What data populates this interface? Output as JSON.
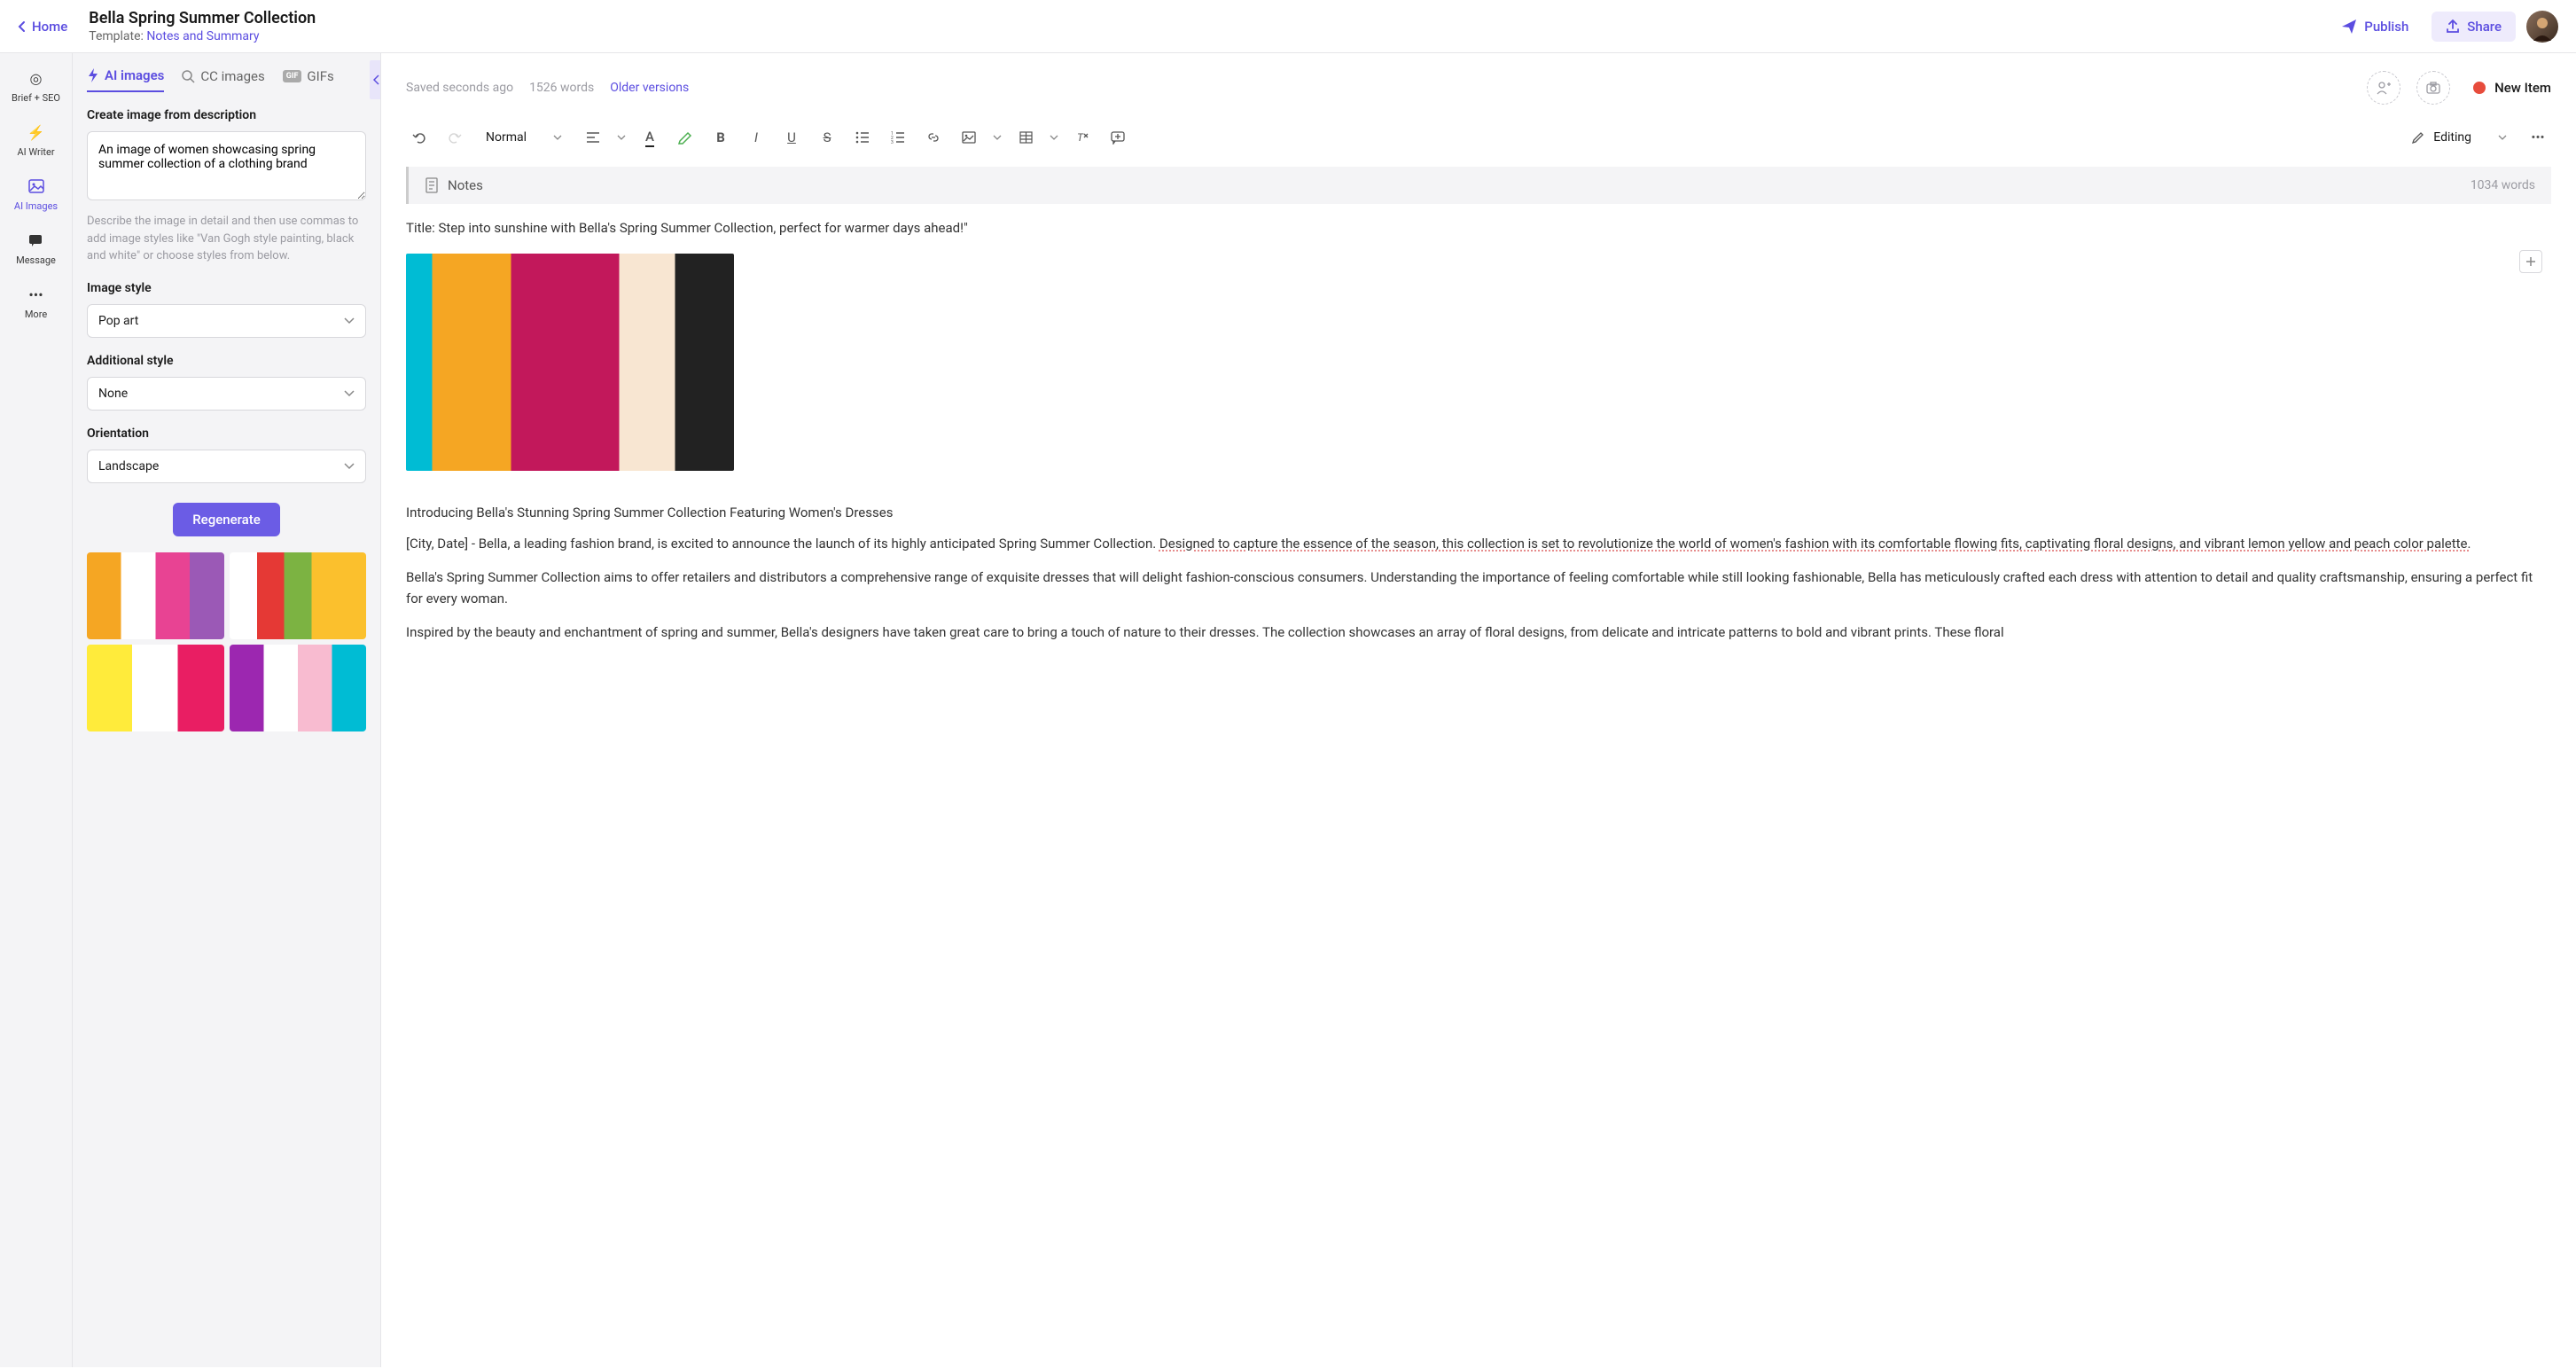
{
  "header": {
    "home": "Home",
    "title": "Bella Spring Summer Collection",
    "template_prefix": "Template: ",
    "template_name": "Notes and Summary",
    "publish": "Publish",
    "share": "Share"
  },
  "rail": {
    "brief": "Brief + SEO",
    "writer": "AI Writer",
    "images": "AI Images",
    "message": "Message",
    "more": "More"
  },
  "panel": {
    "tabs": {
      "ai": "AI images",
      "cc": "CC images",
      "gifs": "GIFs"
    },
    "desc_label": "Create image from description",
    "desc_value": "An image of women showcasing spring summer collection of a clothing brand",
    "desc_hint": "Describe the image in detail and then use commas to add image styles like \"Van Gogh style painting, black and white\" or choose styles from below.",
    "style_label": "Image style",
    "style_value": "Pop art",
    "addl_label": "Additional style",
    "addl_value": "None",
    "orient_label": "Orientation",
    "orient_value": "Landscape",
    "regenerate": "Regenerate"
  },
  "editor": {
    "saved": "Saved seconds ago",
    "words": "1526 words",
    "versions": "Older versions",
    "new_item": "New Item",
    "format": "Normal",
    "editing": "Editing",
    "notes_label": "Notes",
    "notes_words": "1034 words"
  },
  "content": {
    "title_line": "Title: Step into sunshine with Bella's Spring Summer Collection, perfect for warmer days ahead!\"",
    "heading": "Introducing Bella's Stunning Spring Summer Collection Featuring Women's Dresses",
    "p1_a": "[City, Date] - Bella, a leading fashion brand, is excited to announce the launch of its highly anticipated Spring Summer Collection. ",
    "p1_b": "Designed to capture the essence of the season, this collection is set to revolutionize the world of women's fashion with its comfortable flowing fits, captivating floral designs, and vibrant lemon yellow and peach color palette.",
    "p2": "Bella's Spring Summer Collection aims to offer retailers and distributors a comprehensive range of exquisite dresses that will delight fashion-conscious consumers. Understanding the importance of feeling comfortable while still looking fashionable, Bella has meticulously crafted each dress with attention to detail and quality craftsmanship, ensuring a perfect fit for every woman.",
    "p3": "Inspired by the beauty and enchantment of spring and summer, Bella's designers have taken great care to bring a touch of nature to their dresses. The collection showcases an array of floral designs, from delicate and intricate patterns to bold and vibrant prints. These floral"
  }
}
